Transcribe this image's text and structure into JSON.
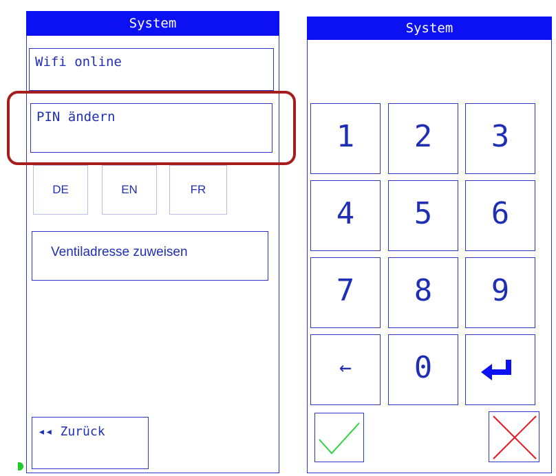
{
  "left": {
    "title": "System",
    "wifi_label": "Wifi online",
    "pin_label": "PIN ändern",
    "languages": [
      "DE",
      "EN",
      "FR"
    ],
    "valve_label": "Ventiladresse zuweisen",
    "back_label": "◂◂ Zurück"
  },
  "right": {
    "title": "System",
    "keys": [
      "1",
      "2",
      "3",
      "4",
      "5",
      "6",
      "7",
      "8",
      "9",
      "←",
      "0"
    ],
    "colors": {
      "accent": "#0b11f3",
      "text": "#1f2fb5",
      "ok": "#2fd23c",
      "cancel": "#e8161d",
      "highlight": "#a51d1d"
    }
  }
}
